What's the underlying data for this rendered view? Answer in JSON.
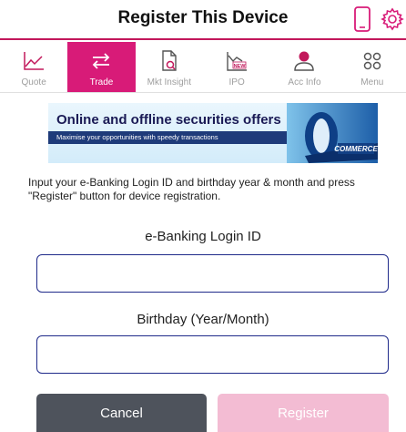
{
  "header": {
    "title": "Register This Device",
    "icons": [
      "phone-icon",
      "gear-icon"
    ]
  },
  "nav": {
    "items": [
      {
        "label": "Quote",
        "icon": "line-chart-icon"
      },
      {
        "label": "Trade",
        "icon": "exchange-arrows-icon",
        "active": true
      },
      {
        "label": "Mkt Insight",
        "icon": "document-search-icon"
      },
      {
        "label": "IPO",
        "icon": "new-chart-icon"
      },
      {
        "label": "Acc Info",
        "icon": "person-icon"
      },
      {
        "label": "Menu",
        "icon": "menu-grid-icon"
      }
    ]
  },
  "banner": {
    "headline": "Online and offline securities offers",
    "subline": "Maximise your opportunities with speedy transactions"
  },
  "form": {
    "instruction": "Input your e-Banking Login ID and birthday year & month and press \"Register\" button for device registration.",
    "login_label": "e-Banking Login ID",
    "login_value": "",
    "birthday_label": "Birthday (Year/Month)",
    "birthday_value": ""
  },
  "buttons": {
    "cancel": "Cancel",
    "register": "Register"
  },
  "colors": {
    "accent": "#d81b78",
    "register_disabled": "#f3bcd3",
    "cancel": "#4e535c",
    "input_border": "#1f2a8a"
  }
}
